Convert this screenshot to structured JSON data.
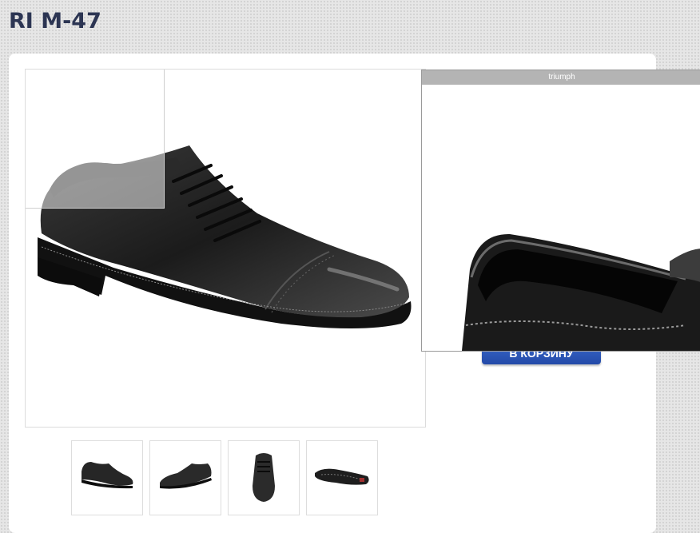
{
  "product": {
    "title": "RI M-47"
  },
  "zoom": {
    "label": "triumph"
  },
  "actions": {
    "cart_label": "В КОРЗИНУ"
  },
  "thumbnails": [
    {
      "icon": "shoe-side-view-icon"
    },
    {
      "icon": "shoe-angled-view-icon"
    },
    {
      "icon": "shoe-front-view-icon"
    },
    {
      "icon": "shoe-sole-view-icon"
    }
  ],
  "colors": {
    "title": "#2c3553",
    "cart_button": "#2f5bbd",
    "zoom_header": "#b4b4b4"
  }
}
